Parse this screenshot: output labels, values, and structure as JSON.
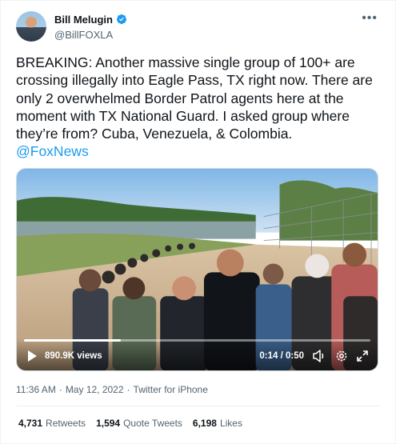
{
  "author": {
    "display_name": "Bill Melugin",
    "handle": "@BillFOXLA",
    "verified": true
  },
  "tweet": {
    "text": "BREAKING: Another massive single group of 100+ are crossing illegally into Eagle Pass, TX right now. There are only 2 overwhelmed Border Patrol agents here at the moment with TX National Guard. I asked group where they’re from? Cuba, Venezuela, & Colombia.",
    "mention": "@FoxNews"
  },
  "video": {
    "views": "890.9K views",
    "time": "0:14 / 0:50",
    "progress": 0.28
  },
  "meta": {
    "time": "11:36 AM",
    "separator": "·",
    "date": "May 12, 2022",
    "source": "Twitter for iPhone"
  },
  "stats": {
    "retweets_count": "4,731",
    "retweets_label": "Retweets",
    "quotes_count": "1,594",
    "quotes_label": "Quote Tweets",
    "likes_count": "6,198",
    "likes_label": "Likes"
  },
  "colors": {
    "link": "#1d9bf0",
    "verified": "#1d9bf0",
    "secondary_text": "#536471"
  },
  "icons": [
    "verified-badge-icon",
    "more-options-icon",
    "play-icon",
    "volume-icon",
    "settings-icon",
    "fullscreen-icon"
  ]
}
